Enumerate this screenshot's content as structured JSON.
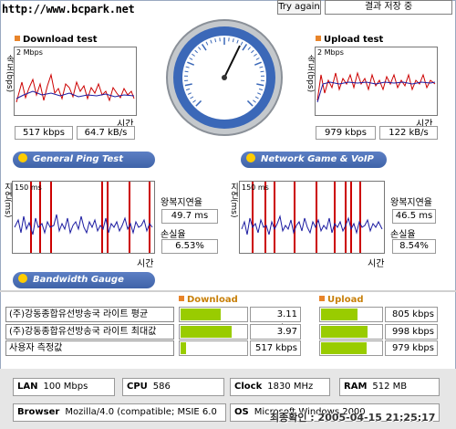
{
  "header": {
    "url": "http://www.bcpark.net",
    "try_again": "Try again",
    "save_result": "결과 저장 중"
  },
  "download": {
    "title": "Download test",
    "y_axis": "속도(bps)",
    "max": "2 Mbps",
    "x_axis": "시간",
    "kbps": "517 kbps",
    "kBs": "64.7 kB/s"
  },
  "upload": {
    "title": "Upload test",
    "y_axis": "속도(bps)",
    "max": "2 Mbps",
    "x_axis": "시간",
    "kbps": "979 kbps",
    "kBs": "122 kB/s"
  },
  "sections": {
    "ping": "General Ping Test",
    "game": "Network Game & VoIP Test",
    "bandwidth": "Bandwidth Gauge"
  },
  "ping": {
    "y_axis": "ms)",
    "y_axis_prefix": "지연(",
    "max": "150 ms",
    "x_axis": "시간",
    "latency_label": "왕복지연율",
    "latency": "49.7 ms",
    "loss_label": "손실율",
    "loss": "6.53%"
  },
  "game": {
    "y_axis": "ms)",
    "y_axis_prefix": "지연(",
    "max": "150 ms",
    "x_axis": "시간",
    "latency_label": "왕복지연율",
    "latency": "46.5 ms",
    "loss_label": "손실율",
    "loss": "8.54%"
  },
  "gauge": {
    "download_header": "Download",
    "upload_header": "Upload",
    "rows": [
      {
        "label": "(주)강동종합유선방송국 라이트 평균",
        "down": "3.11 Mbps",
        "down_frac": 0.62,
        "up": "805 kbps",
        "up_frac": 0.62
      },
      {
        "label": "(주)강동종합유선방송국 라이트 최대값",
        "down": "3.97 Mbps",
        "down_frac": 0.79,
        "up": "998 kbps",
        "up_frac": 0.78
      },
      {
        "label": "사용자 측정값",
        "down": "517 kbps",
        "down_frac": 0.11,
        "up": "979 kbps",
        "up_frac": 0.76
      }
    ]
  },
  "system": {
    "lan_label": "LAN",
    "lan": "100 Mbps",
    "cpu_label": "CPU",
    "cpu": "586",
    "clock_label": "Clock",
    "clock": "1830 MHz",
    "ram_label": "RAM",
    "ram": "512 MB",
    "browser_label": "Browser",
    "browser": "Mozilla/4.0 (compatible; MSIE 6.0",
    "os_label": "OS",
    "os": "Microsoft Windows 2000"
  },
  "footer": {
    "timestamp": "최종확인 : 2005-04-15 21:25:17"
  },
  "colors": {
    "accent_blue": "#4a6fb5",
    "bar_green": "#99cc00",
    "series_red": "#cc0000",
    "series_blue": "#1a1aa0"
  }
}
